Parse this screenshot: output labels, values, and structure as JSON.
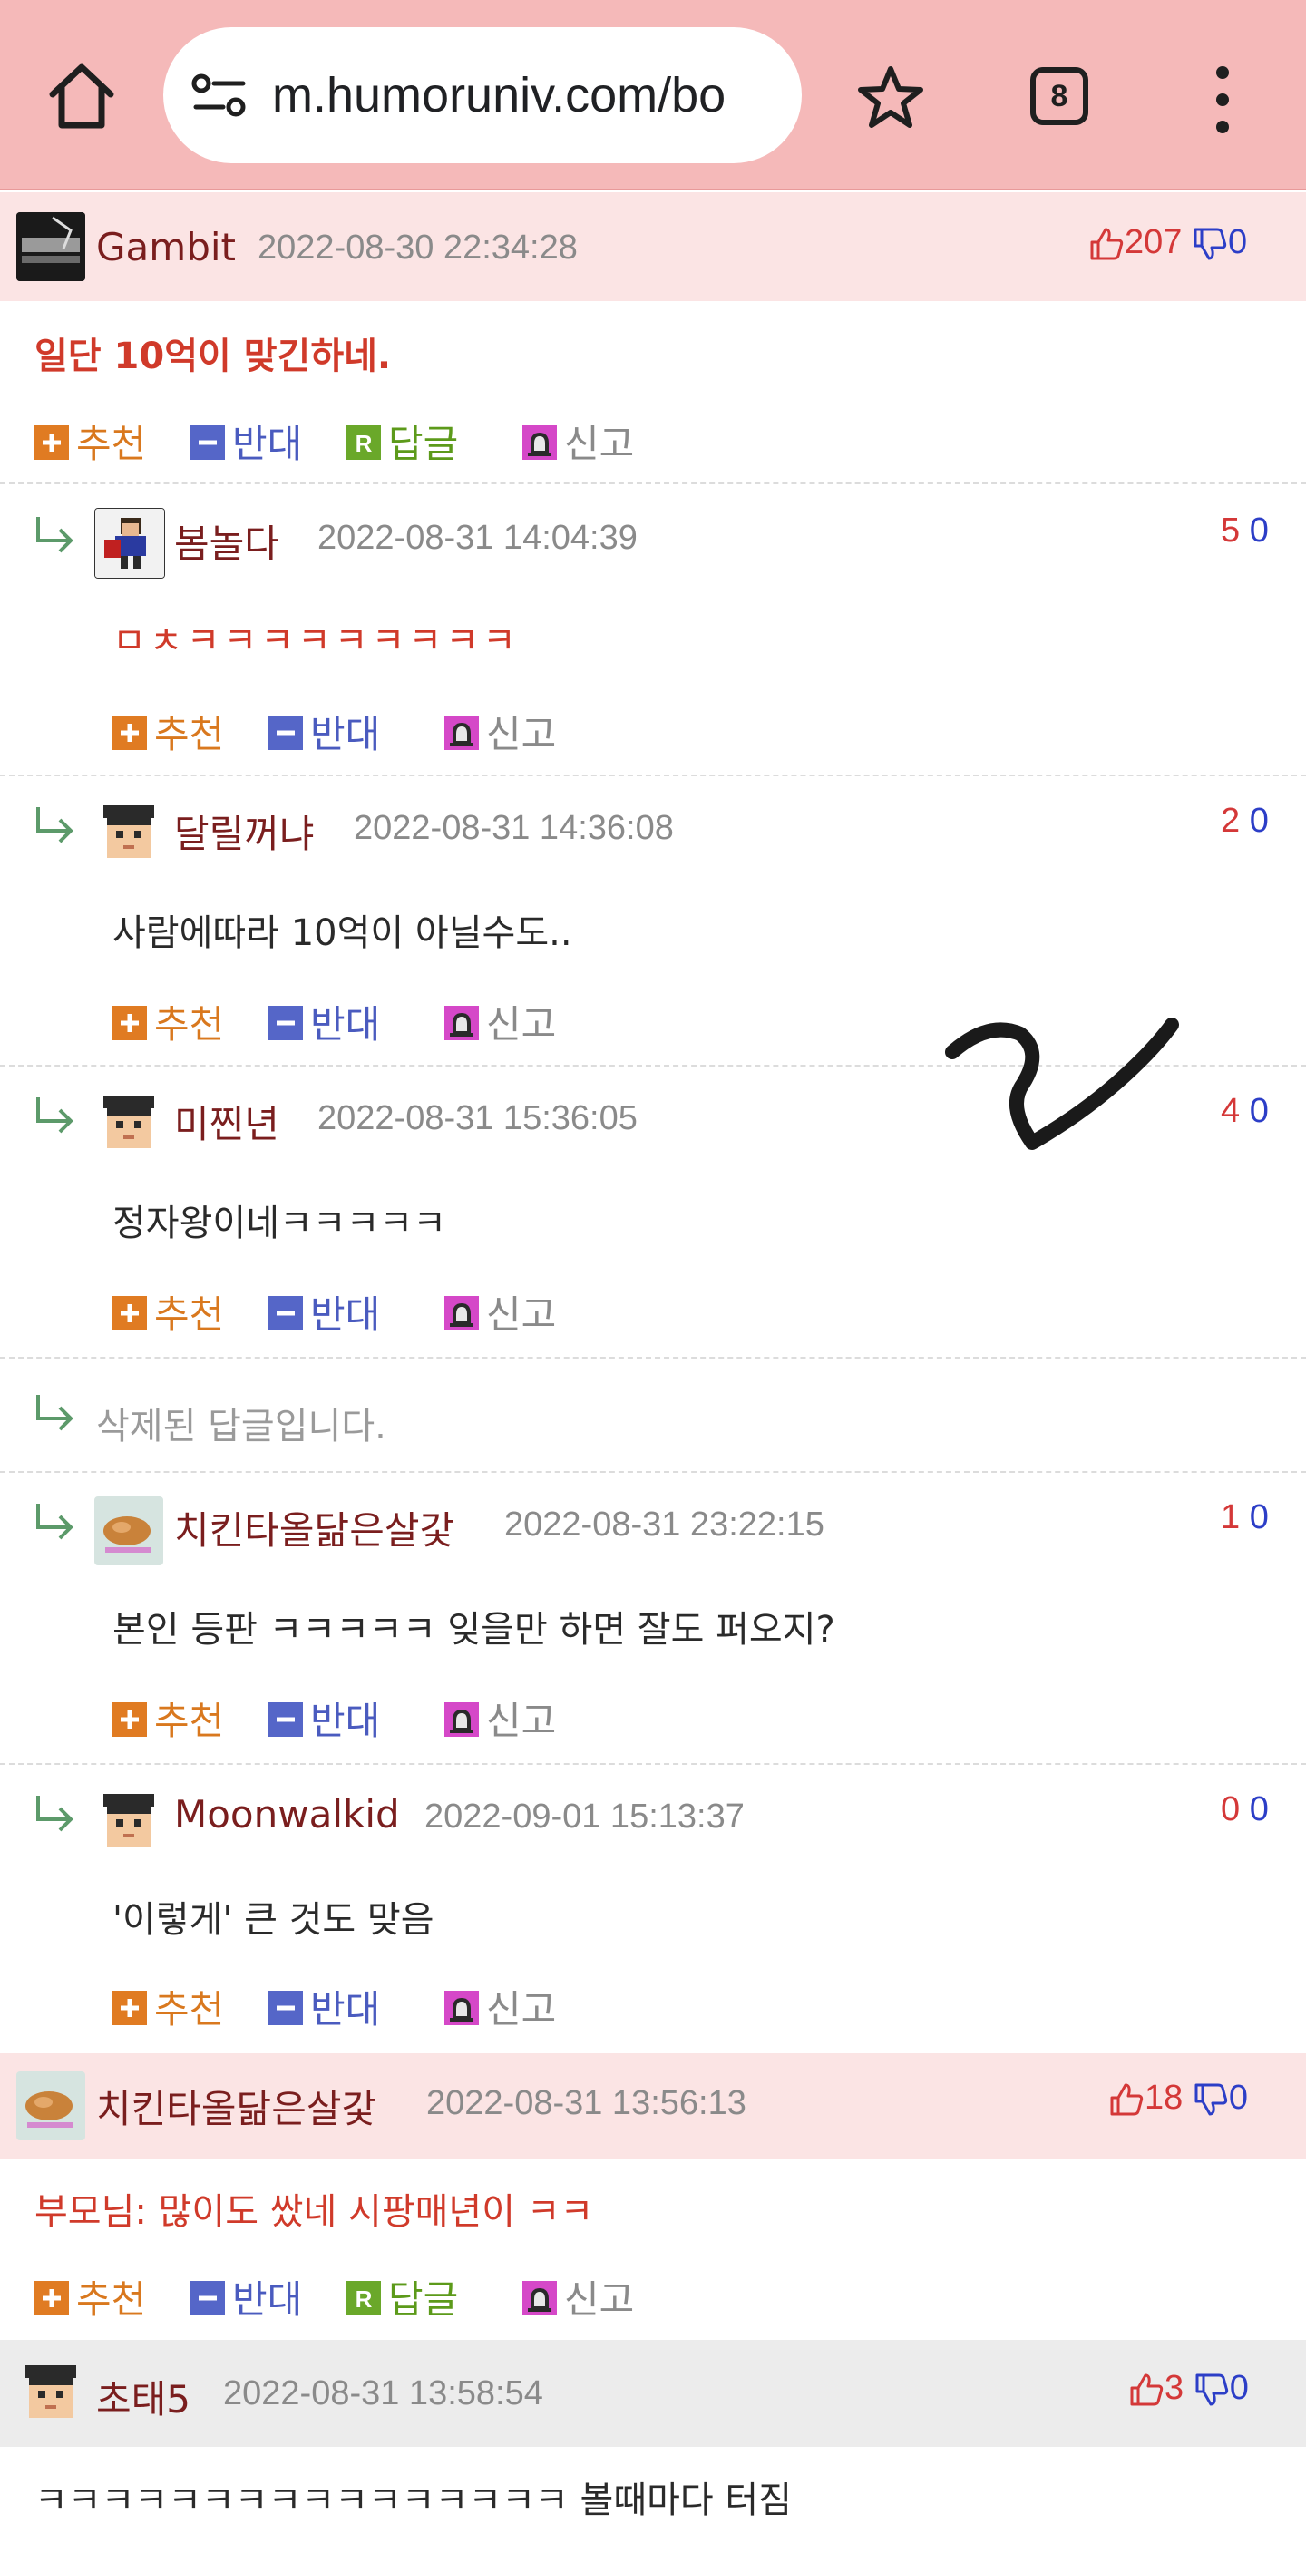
{
  "browser": {
    "url": "m.humoruniv.com/bo",
    "tab_count": "8"
  },
  "colors": {
    "topbar": "#f5b9b9",
    "highlight_row": "#fbe4e4",
    "gray_row": "#ececec",
    "recommend": "#d9781e",
    "oppose": "#4a5bbf",
    "reply": "#5c9a1a",
    "up": "#d43838",
    "down": "#2c3ec7"
  },
  "actions": {
    "recommend": "추천",
    "oppose": "반대",
    "reply": "답글",
    "report": "신고"
  },
  "comments": [
    {
      "author": "Gambit",
      "date": "2022-08-30 22:34:28",
      "up": "207",
      "down": "0",
      "text": "일단 10억이 맞긴하네."
    },
    {
      "author": "봄놀다",
      "date": "2022-08-31 14:04:39",
      "up": "5",
      "down": "0",
      "text": "ㅁㅊㅋㅋㅋㅋㅋㅋㅋㅋㅋ"
    },
    {
      "author": "달릴꺼냐",
      "date": "2022-08-31 14:36:08",
      "up": "2",
      "down": "0",
      "text": "사람에따라 10억이 아닐수도.."
    },
    {
      "author": "미찐년",
      "date": "2022-08-31 15:36:05",
      "up": "4",
      "down": "0",
      "text": "정자왕이네ㅋㅋㅋㅋㅋ"
    },
    {
      "deleted_text": "삭제된 답글입니다."
    },
    {
      "author": "치킨타올닮은살갗",
      "date": "2022-08-31 23:22:15",
      "up": "1",
      "down": "0",
      "text": "본인 등판 ㅋㅋㅋㅋㅋ 잊을만 하면 잘도 퍼오지?"
    },
    {
      "author": "Moonwalkid",
      "date": "2022-09-01 15:13:37",
      "up": "0",
      "down": "0",
      "text": "'이렇게' 큰 것도 맞음"
    },
    {
      "author": "치킨타올닮은살갗",
      "date": "2022-08-31 13:56:13",
      "up": "18",
      "down": "0",
      "text": "부모님: 많이도 쌌네 시팡매년이 ㅋㅋ"
    },
    {
      "author": "초태5",
      "date": "2022-08-31 13:58:54",
      "up": "3",
      "down": "0",
      "text": "ㅋㅋㅋㅋㅋㅋㅋㅋㅋㅋㅋㅋㅋㅋㅋㅋ 볼때마다 터짐"
    }
  ]
}
